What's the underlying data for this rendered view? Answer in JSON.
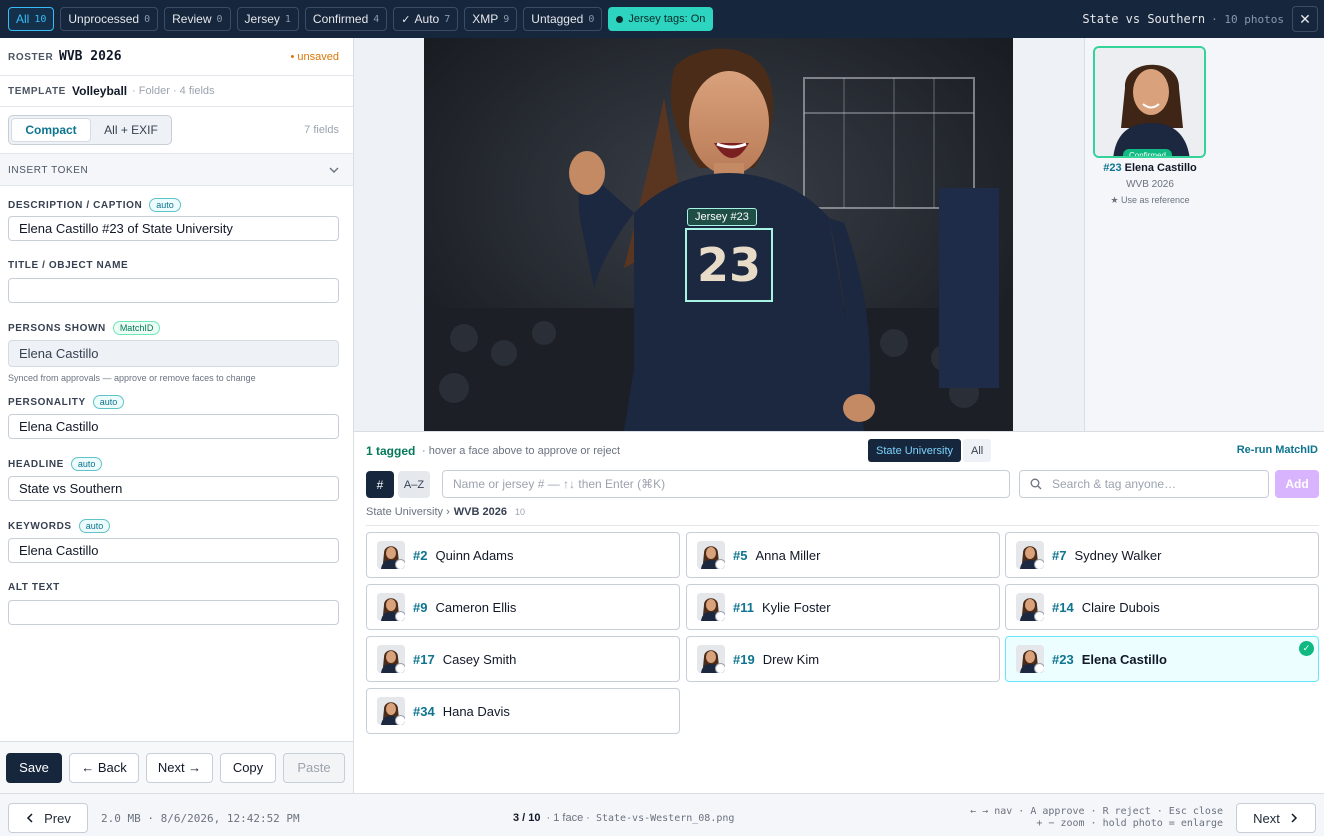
{
  "topbar": {
    "filters": [
      {
        "label": "All",
        "count": "10",
        "active": true
      },
      {
        "label": "Unprocessed",
        "count": "0"
      },
      {
        "label": "Review",
        "count": "0"
      },
      {
        "label": "Jersey",
        "count": "1"
      },
      {
        "label": "Confirmed",
        "count": "4"
      },
      {
        "label": "Auto",
        "count": "7",
        "check": "✓"
      },
      {
        "label": "XMP",
        "count": "9"
      },
      {
        "label": "Untagged",
        "count": "0"
      }
    ],
    "jersey_toggle": "Jersey tags: On",
    "event_title": "State vs Southern",
    "event_sub": "· 10 photos",
    "close_icon": "✕"
  },
  "left": {
    "roster_label": "ROSTER",
    "roster_value": "WVB 2026",
    "unsaved": "• unsaved",
    "template_label": "TEMPLATE",
    "template_value": "Volleyball",
    "template_meta": "· Folder · 4 fields",
    "tab_compact": "Compact",
    "tab_all": "All + EXIF",
    "field_count": "7 fields",
    "insert_token": "INSERT TOKEN",
    "fields": [
      {
        "label": "DESCRIPTION / CAPTION",
        "badge": "auto",
        "value": "Elena Castillo #23 of State University"
      },
      {
        "label": "TITLE / OBJECT NAME",
        "badge": "",
        "value": ""
      },
      {
        "label": "PERSONS SHOWN",
        "badge": "MatchID",
        "value": "Elena Castillo",
        "help": "Synced from approvals — approve or remove faces to change"
      },
      {
        "label": "PERSONALITY",
        "badge": "auto",
        "value": "Elena Castillo"
      },
      {
        "label": "HEADLINE",
        "badge": "auto",
        "value": "State vs Southern"
      },
      {
        "label": "KEYWORDS",
        "badge": "auto",
        "value": "Elena Castillo"
      },
      {
        "label": "ALT TEXT",
        "badge": "",
        "value": ""
      }
    ],
    "buttons": {
      "save": "Save",
      "back": "← Back",
      "next": "Next →",
      "copy": "Copy",
      "paste": "Paste"
    }
  },
  "viewer": {
    "jersey_tag": "Jersey #23",
    "jersey_number": "23"
  },
  "reference": {
    "badge": "Confirmed",
    "number": "#23",
    "name": "Elena Castillo",
    "team": "WVB 2026",
    "use_ref": "★ Use as reference"
  },
  "tagging": {
    "tagged": "1 tagged",
    "hint": "· hover a face above to approve or reject",
    "team_tabs": [
      "State University",
      "All"
    ],
    "rerun": "Re-run MatchID",
    "sort_num": "#",
    "sort_az": "A–Z",
    "name_placeholder": "Name or jersey # — ↑↓ then Enter (⌘K)",
    "search_placeholder": "Search & tag anyone…",
    "add": "Add",
    "crumb_team": "State University ›",
    "crumb_roster": "WVB 2026",
    "crumb_count": "10",
    "players": [
      {
        "num": "#2",
        "name": "Quinn Adams"
      },
      {
        "num": "#5",
        "name": "Anna Miller"
      },
      {
        "num": "#7",
        "name": "Sydney Walker"
      },
      {
        "num": "#9",
        "name": "Cameron Ellis"
      },
      {
        "num": "#11",
        "name": "Kylie Foster"
      },
      {
        "num": "#14",
        "name": "Claire Dubois"
      },
      {
        "num": "#17",
        "name": "Casey Smith"
      },
      {
        "num": "#19",
        "name": "Drew Kim"
      },
      {
        "num": "#23",
        "name": "Elena Castillo",
        "selected": true
      },
      {
        "num": "#34",
        "name": "Hana Davis"
      }
    ]
  },
  "status": {
    "prev": "Prev",
    "meta": "2.0 MB · 8/6/2026, 12:42:52 PM",
    "position": "3 / 10",
    "faces": "· 1 face ·",
    "filename": "State-vs-Western_08.png",
    "hint1": "← → nav · A approve · R reject · Esc close",
    "hint2": "+ − zoom · hold photo = enlarge",
    "next": "Next"
  },
  "colors": {
    "navy": "#16263d",
    "accent": "#38bdf8",
    "teal": "#2dd4bf",
    "confirmed": "#10b981"
  }
}
